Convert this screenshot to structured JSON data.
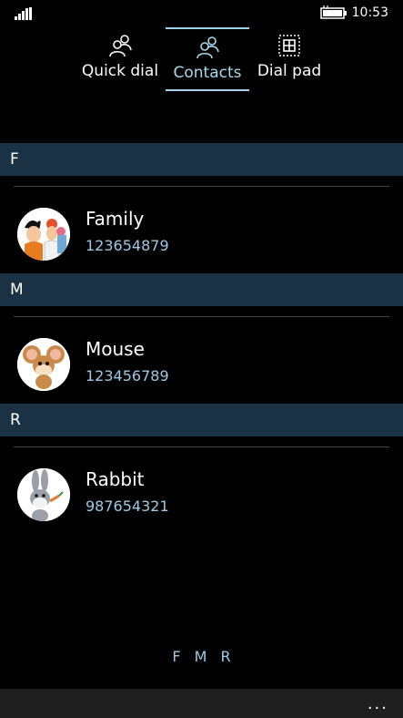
{
  "status": {
    "time": "10:53"
  },
  "tabs": [
    {
      "label": "Quick dial",
      "icon": "people-icon",
      "active": false
    },
    {
      "label": "Contacts",
      "icon": "people-icon",
      "active": true
    },
    {
      "label": "Dial pad",
      "icon": "dialpad-icon",
      "active": false
    }
  ],
  "sections": [
    {
      "letter": "F",
      "contact": {
        "name": "Family",
        "phone": "123654879",
        "avatar": "flintstones-family-avatar"
      }
    },
    {
      "letter": "M",
      "contact": {
        "name": "Mouse",
        "phone": "123456789",
        "avatar": "jerry-mouse-avatar"
      }
    },
    {
      "letter": "R",
      "contact": {
        "name": "Rabbit",
        "phone": "987654321",
        "avatar": "bugs-bunny-avatar"
      }
    }
  ],
  "jump_index": [
    "F",
    "M",
    "R"
  ],
  "app_bar": {
    "more_label": "..."
  },
  "colors": {
    "accent": "#9fc9e6",
    "section_bg": "#1b3245",
    "background": "#000000"
  }
}
